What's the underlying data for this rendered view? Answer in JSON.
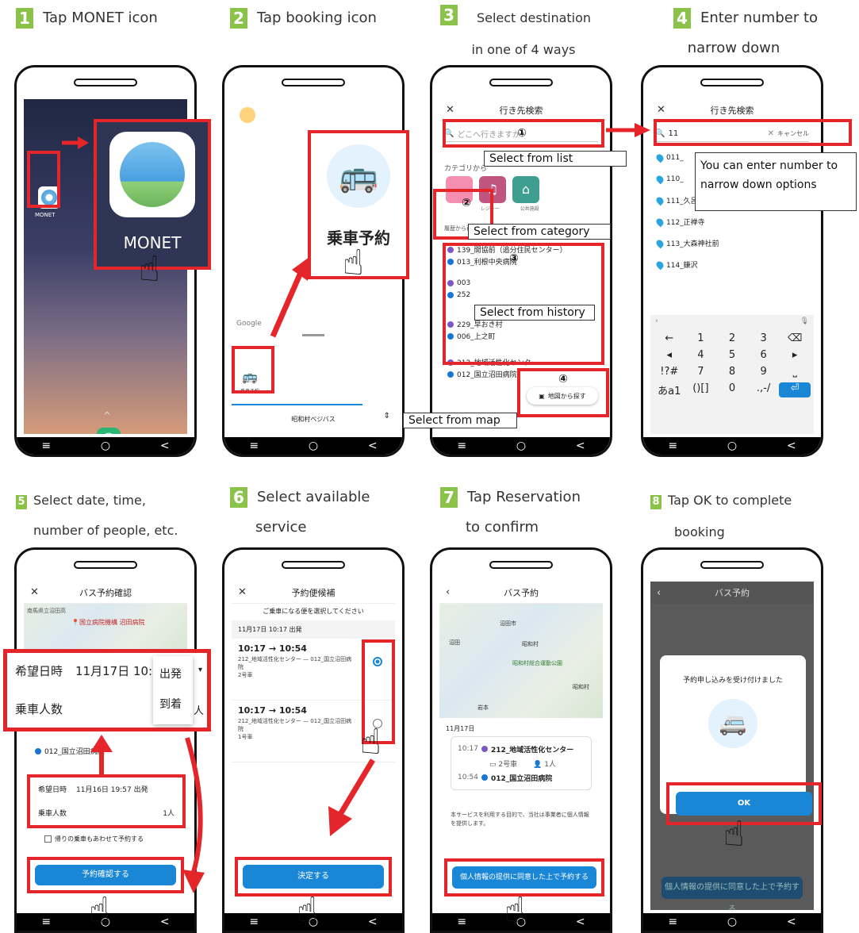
{
  "steps": [
    {
      "num": "1",
      "line1": "Tap MONET icon",
      "line2": ""
    },
    {
      "num": "2",
      "line1": "Tap booking icon",
      "line2": ""
    },
    {
      "num": "3",
      "line1": "Select destination",
      "line2": "in one of 4 ways"
    },
    {
      "num": "4",
      "line1": "Enter number to",
      "line2": "narrow down"
    },
    {
      "num": "5",
      "line1": "Select date, time,",
      "line2": "number of people, etc."
    },
    {
      "num": "6",
      "line1": "Select available",
      "line2": "service"
    },
    {
      "num": "7",
      "line1": "Tap Reservation",
      "line2": "to confirm"
    },
    {
      "num": "8",
      "line1": "Tap OK to complete",
      "line2": "booking"
    }
  ],
  "nav": {
    "menu": "≡",
    "home": "○",
    "back": "<"
  },
  "p1": {
    "app_small": "MONET",
    "app_big": "MONET",
    "caret": "^"
  },
  "p2": {
    "booking_big": "乗車予約",
    "booking_small": "乗車予約",
    "route": "昭和村ベジバス",
    "google": "Google"
  },
  "p3": {
    "title": "行き先検索",
    "search_placeholder": "どこへ行きますか?",
    "category_label": "カテゴリから",
    "history_label": "履歴から再予約",
    "cat1": "",
    "cat2": "レジャー",
    "cat3": "公共施設",
    "history": [
      "139_開協前（追分住民センター）",
      "013_利根中央病院",
      "003",
      "252",
      "229_早おき村",
      "006_上之町"
    ],
    "list": [
      "212_地域活性化センター",
      "012_国立沼田病院"
    ],
    "map_btn": "地図から探す",
    "callouts": {
      "list": "Select from list",
      "category": "Select from category",
      "history": "Select from history",
      "map": "Select from map"
    },
    "circ": [
      "①",
      "②",
      "③",
      "④"
    ]
  },
  "p4": {
    "title": "行き先検索",
    "query": "11",
    "cancel": "キャンセル",
    "callout_line1": "You can enter number to",
    "callout_line2": "narrow down options",
    "results": [
      "011_",
      "110_",
      "111_久呂保農協前",
      "112_正禅寺",
      "113_大森神社前",
      "114_鎌沢"
    ],
    "keys": [
      [
        "←",
        "1",
        "2",
        "3",
        "⌫"
      ],
      [
        "◂",
        "4",
        "5",
        "6",
        "▸"
      ],
      [
        "!?#",
        "7",
        "8",
        "9",
        "⎵"
      ],
      [
        "あa1",
        "()[]",
        "0",
        ".,-/",
        "⏎"
      ]
    ]
  },
  "p5": {
    "title": "バス予約確認",
    "place_top": "国立病院機構 沼田病院",
    "place_small": "南馬県立沼田高",
    "zoom_date_label": "希望日時",
    "zoom_date": "11月17日 10:17",
    "depart": "出発",
    "arrive": "到着",
    "zoom_people_label": "乗車人数",
    "zoom_people": "1人",
    "dest": "012_国立沼田病院",
    "date_label": "希望日時",
    "date": "11月16日 19:57 出発",
    "people_label": "乗車人数",
    "people": "1人",
    "return_label": "帰りの乗車もあわせて予約する",
    "confirm_btn": "予約確認する"
  },
  "p6": {
    "title": "予約便候補",
    "subtitle": "ご乗車になる便を選択してください",
    "header": "11月17日 10:17 出発",
    "services": [
      {
        "time": "10:17 → 10:54",
        "route": "212_地域活性化センター — 012_国立沼田病院",
        "car": "2号車"
      },
      {
        "time": "10:17 → 10:54",
        "route": "212_地域活性化センター — 012_国立沼田病院",
        "car": "1号車"
      }
    ],
    "decide_btn": "決定する"
  },
  "p7": {
    "title": "バス予約",
    "date": "11月17日",
    "dep_time": "10:17",
    "dep_stop": "212_地域活性化センター",
    "car": "2号車",
    "people": "1人",
    "arr_time": "10:54",
    "arr_stop": "012_国立沼田病院",
    "notice": "本サービスを利用する目的で、当社は事業者に個人情報を提供します。",
    "reserve_btn": "個人情報の提供に同意した上で予約する",
    "map_labels": [
      "沼田市",
      "沼田",
      "昭和村",
      "昭和村総合運動公園",
      "昭和村",
      "岩本"
    ]
  },
  "p8": {
    "title": "バス予約",
    "dialog_text": "予約申し込みを受け付けました",
    "ok_btn": "OK",
    "bg_btn": "個人情報の提供に同意した上で予約する"
  },
  "colors": {
    "accent": "#1a86d6",
    "highlight": "#e4262b",
    "step_badge": "#8bc34a"
  }
}
